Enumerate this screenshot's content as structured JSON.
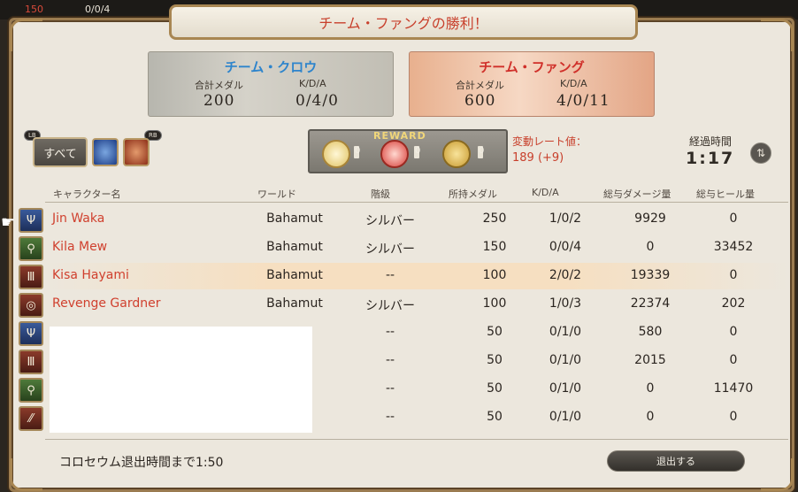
{
  "hud": {
    "left_value": "150",
    "kda": "0/0/4"
  },
  "title": "チーム・ファングの勝利！",
  "teams": {
    "crow": {
      "name": "チーム・クロウ",
      "medal_label": "合計メダル",
      "kda_label": "K/D/A",
      "medals": "200",
      "kda": "0/4/0",
      "color": "#2d84cc"
    },
    "fang": {
      "name": "チーム・ファング",
      "medal_label": "合計メダル",
      "kda_label": "K/D/A",
      "medals": "600",
      "kda": "4/0/11",
      "color": "#d0302a"
    }
  },
  "filter": {
    "lb": "LB",
    "rb": "RB",
    "all_label": "すべて",
    "icons": [
      "team-crow-icon",
      "team-fang-icon"
    ]
  },
  "reward": {
    "title": "REWARD",
    "counts": [
      "0",
      "0",
      "0"
    ]
  },
  "rate": {
    "label": "変動レート値：",
    "value": "189 (+9)"
  },
  "elapsed": {
    "label": "経過時間",
    "value": "1:17"
  },
  "columns": {
    "name": "キャラクター名",
    "world": "ワールド",
    "rank": "階級",
    "medals": "所持メダル",
    "kda": "K/D/A",
    "damage": "総与ダメージ量",
    "heal": "総与ヒール量"
  },
  "players": [
    {
      "name": "Jin Waka",
      "world": "Bahamut",
      "rank": "シルバー",
      "medals": "250",
      "kda": "1/0/2",
      "damage": "9929",
      "heal": "0",
      "job": "blue",
      "glyph": "Ψ"
    },
    {
      "name": "Kila Mew",
      "world": "Bahamut",
      "rank": "シルバー",
      "medals": "150",
      "kda": "0/0/4",
      "damage": "0",
      "heal": "33452",
      "job": "green",
      "glyph": "⚲"
    },
    {
      "name": "Kisa Hayami",
      "world": "Bahamut",
      "rank": "--",
      "medals": "100",
      "kda": "2/0/2",
      "damage": "19339",
      "heal": "0",
      "job": "red",
      "glyph": "Ⅲ"
    },
    {
      "name": "Revenge Gardner",
      "world": "Bahamut",
      "rank": "シルバー",
      "medals": "100",
      "kda": "1/0/3",
      "damage": "22374",
      "heal": "202",
      "job": "red",
      "glyph": "◎"
    },
    {
      "name": "",
      "world": "",
      "rank": "--",
      "medals": "50",
      "kda": "0/1/0",
      "damage": "580",
      "heal": "0",
      "job": "blue",
      "glyph": "Ψ"
    },
    {
      "name": "",
      "world": "",
      "rank": "--",
      "medals": "50",
      "kda": "0/1/0",
      "damage": "2015",
      "heal": "0",
      "job": "red",
      "glyph": "Ⅲ"
    },
    {
      "name": "",
      "world": "",
      "rank": "--",
      "medals": "50",
      "kda": "0/1/0",
      "damage": "0",
      "heal": "11470",
      "job": "green",
      "glyph": "⚲"
    },
    {
      "name": "",
      "world": "",
      "rank": "--",
      "medals": "50",
      "kda": "0/1/0",
      "damage": "0",
      "heal": "0",
      "job": "red",
      "glyph": "⁄⁄"
    }
  ],
  "footer": {
    "countdown": "コロセウム退出時間まで1:50",
    "exit_label": "退出する"
  }
}
